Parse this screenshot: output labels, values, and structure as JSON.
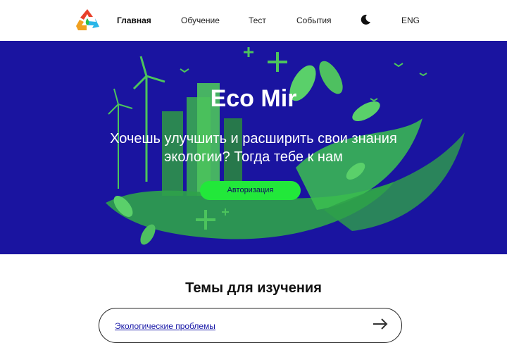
{
  "header": {
    "nav": [
      {
        "label": "Главная",
        "active": true
      },
      {
        "label": "Обучение",
        "active": false
      },
      {
        "label": "Тест",
        "active": false
      },
      {
        "label": "События",
        "active": false
      }
    ],
    "theme_icon": "moon-icon",
    "lang_label": "ENG",
    "logo_icon": "recycle-logo-icon"
  },
  "hero": {
    "title": "Eco Mir",
    "subtitle": "Хочешь улучшить и расширить свои знания экологии? Тогда тебе к нам",
    "auth_button": "Авторизация",
    "background_color": "#1a14a0",
    "accent_color": "#22e83a"
  },
  "topics": {
    "title": "Темы для изучения",
    "items": [
      {
        "label": "Экологические проблемы",
        "icon": "arrow-right-icon"
      }
    ]
  }
}
